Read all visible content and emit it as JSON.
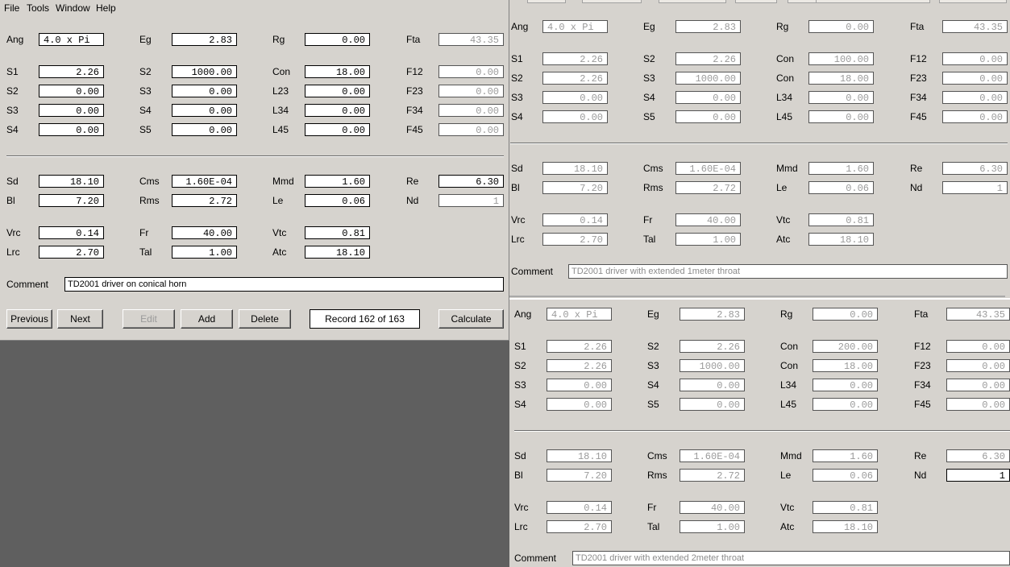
{
  "menu": [
    "File",
    "Tools",
    "Window",
    "Help"
  ],
  "main": {
    "labels": {
      "ang": "Ang",
      "eg": "Eg",
      "rg": "Rg",
      "fta": "Fta",
      "s1": "S1",
      "s2b": "S2",
      "con": "Con",
      "f12": "F12",
      "s2": "S2",
      "s3b": "S3",
      "l23": "L23",
      "f23": "F23",
      "s3": "S3",
      "s4b": "S4",
      "l34": "L34",
      "f34": "F34",
      "s4": "S4",
      "s5": "S5",
      "l45": "L45",
      "f45": "F45",
      "sd": "Sd",
      "cms": "Cms",
      "mmd": "Mmd",
      "re": "Re",
      "bl": "Bl",
      "rms": "Rms",
      "le": "Le",
      "nd": "Nd",
      "vrc": "Vrc",
      "fr": "Fr",
      "vtc": "Vtc",
      "lrc": "Lrc",
      "tal": "Tal",
      "atc": "Atc",
      "comment": "Comment"
    },
    "values": {
      "ang": "4.0 x Pi",
      "eg": "2.83",
      "rg": "0.00",
      "fta": "43.35",
      "s1": "2.26",
      "s2b": "1000.00",
      "con": "18.00",
      "f12": "0.00",
      "s2": "0.00",
      "s3b": "0.00",
      "l23": "0.00",
      "f23": "0.00",
      "s3": "0.00",
      "s4b": "0.00",
      "l34": "0.00",
      "f34": "0.00",
      "s4": "0.00",
      "s5": "0.00",
      "l45": "0.00",
      "f45": "0.00",
      "sd": "18.10",
      "cms": "1.60E-04",
      "mmd": "1.60",
      "re": "6.30",
      "bl": "7.20",
      "rms": "2.72",
      "le": "0.06",
      "nd": "1",
      "vrc": "0.14",
      "fr": "40.00",
      "vtc": "0.81",
      "lrc": "2.70",
      "tal": "1.00",
      "atc": "18.10",
      "comment": "TD2001 driver on conical horn"
    },
    "buttons": {
      "previous": "Previous",
      "next": "Next",
      "edit": "Edit",
      "add": "Add",
      "delete": "Delete",
      "record": "Record 162 of 163",
      "calculate": "Calculate"
    }
  },
  "record1": {
    "labels": {
      "ang": "Ang",
      "eg": "Eg",
      "rg": "Rg",
      "fta": "Fta",
      "s1": "S1",
      "s2b": "S2",
      "con1": "Con",
      "f12": "F12",
      "s2": "S2",
      "s3b": "S3",
      "con2": "Con",
      "f23": "F23",
      "s3": "S3",
      "s4b": "S4",
      "l34": "L34",
      "f34": "F34",
      "s4": "S4",
      "s5": "S5",
      "l45": "L45",
      "f45": "F45",
      "sd": "Sd",
      "cms": "Cms",
      "mmd": "Mmd",
      "re": "Re",
      "bl": "Bl",
      "rms": "Rms",
      "le": "Le",
      "nd": "Nd",
      "vrc": "Vrc",
      "fr": "Fr",
      "vtc": "Vtc",
      "lrc": "Lrc",
      "tal": "Tal",
      "atc": "Atc",
      "comment": "Comment"
    },
    "values": {
      "ang": "4.0 x Pi",
      "eg": "2.83",
      "rg": "0.00",
      "fta": "43.35",
      "s1": "2.26",
      "s2b": "2.26",
      "con1": "100.00",
      "f12": "0.00",
      "s2": "2.26",
      "s3b": "1000.00",
      "con2": "18.00",
      "f23": "0.00",
      "s3": "0.00",
      "s4b": "0.00",
      "l34": "0.00",
      "f34": "0.00",
      "s4": "0.00",
      "s5": "0.00",
      "l45": "0.00",
      "f45": "0.00",
      "sd": "18.10",
      "cms": "1.60E-04",
      "mmd": "1.60",
      "re": "6.30",
      "bl": "7.20",
      "rms": "2.72",
      "le": "0.06",
      "nd": "1",
      "vrc": "0.14",
      "fr": "40.00",
      "vtc": "0.81",
      "lrc": "2.70",
      "tal": "1.00",
      "atc": "18.10",
      "comment": "TD2001 driver with extended 1meter  throat"
    }
  },
  "record2": {
    "labels": {
      "ang": "Ang",
      "eg": "Eg",
      "rg": "Rg",
      "fta": "Fta",
      "s1": "S1",
      "s2b": "S2",
      "con1": "Con",
      "f12": "F12",
      "s2": "S2",
      "s3b": "S3",
      "con2": "Con",
      "f23": "F23",
      "s3": "S3",
      "s4b": "S4",
      "l34": "L34",
      "f34": "F34",
      "s4": "S4",
      "s5": "S5",
      "l45": "L45",
      "f45": "F45",
      "sd": "Sd",
      "cms": "Cms",
      "mmd": "Mmd",
      "re": "Re",
      "bl": "Bl",
      "rms": "Rms",
      "le": "Le",
      "nd": "Nd",
      "vrc": "Vrc",
      "fr": "Fr",
      "vtc": "Vtc",
      "lrc": "Lrc",
      "tal": "Tal",
      "atc": "Atc",
      "comment": "Comment"
    },
    "values": {
      "ang": "4.0 x Pi",
      "eg": "2.83",
      "rg": "0.00",
      "fta": "43.35",
      "s1": "2.26",
      "s2b": "2.26",
      "con1": "200.00",
      "f12": "0.00",
      "s2": "2.26",
      "s3b": "1000.00",
      "con2": "18.00",
      "f23": "0.00",
      "s3": "0.00",
      "s4b": "0.00",
      "l34": "0.00",
      "f34": "0.00",
      "s4": "0.00",
      "s5": "0.00",
      "l45": "0.00",
      "f45": "0.00",
      "sd": "18.10",
      "cms": "1.60E-04",
      "mmd": "1.60",
      "re": "6.30",
      "bl": "7.20",
      "rms": "2.72",
      "le": "0.06",
      "nd": "1",
      "vrc": "0.14",
      "fr": "40.00",
      "vtc": "0.81",
      "lrc": "2.70",
      "tal": "1.00",
      "atc": "18.10",
      "comment": "TD2001 driver with extended 2meter  throat"
    }
  }
}
